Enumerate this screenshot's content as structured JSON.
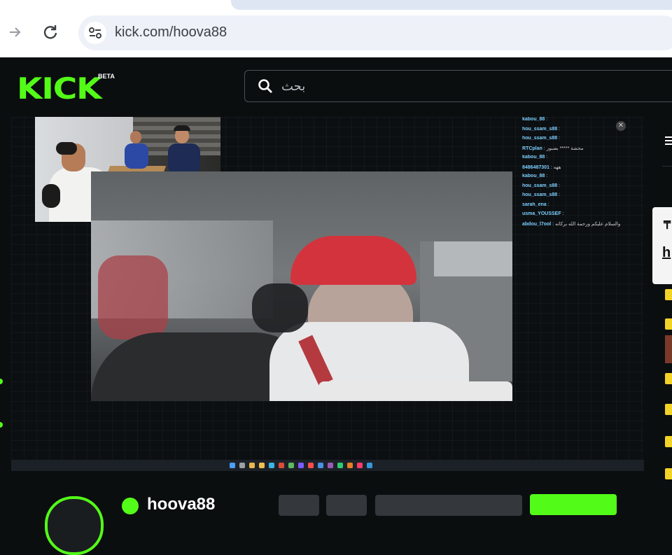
{
  "browser": {
    "url": "kick.com/hoova88",
    "forward_icon": "arrow-right",
    "reload_icon": "reload",
    "site_info_icon": "tune"
  },
  "header": {
    "logo": "KICK",
    "logo_badge": "BETA",
    "search_placeholder": "بحث",
    "accent_color": "#53fc18"
  },
  "stream_chat": [
    {
      "user": "kabou_88",
      "msg": ""
    },
    {
      "user": "hou_ssam_s88",
      "msg": ""
    },
    {
      "user": "hou_ssam_s88",
      "msg": ""
    },
    {
      "user": "RTCplan",
      "msg": "محشة ***** بصبور"
    },
    {
      "user": "kabou_88",
      "msg": ""
    },
    {
      "user": "8486487301",
      "msg": "ههه"
    },
    {
      "user": "kabou_88",
      "msg": ""
    },
    {
      "user": "hou_ssam_s88",
      "msg": ""
    },
    {
      "user": "hou_ssam_s88",
      "msg": ""
    },
    {
      "user": "sarah_ena",
      "msg": ""
    },
    {
      "user": "usma_YOUSSEF",
      "msg": ""
    },
    {
      "user": "abdou_l7ool",
      "msg": "والسلام عليكم ورحمة الله بركاته"
    }
  ],
  "channel": {
    "name": "hoova88",
    "follow_color": "#53fc18"
  },
  "right_rail": {
    "menu_icon": "menu",
    "tooltip_text": "h"
  }
}
